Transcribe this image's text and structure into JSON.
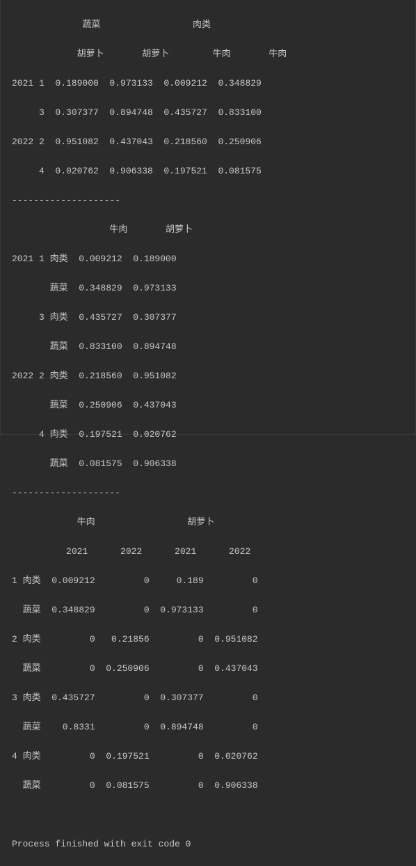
{
  "separator": "--------------------",
  "exit_message": "Process finished with exit code 0",
  "block1": {
    "header1": "             蔬菜                 肉类          ",
    "header2": "            胡萝卜       胡萝卜        牛肉       牛肉",
    "rows": [
      "2021 1  0.189000  0.973133  0.009212  0.348829",
      "     3  0.307377  0.894748  0.435727  0.833100",
      "2022 2  0.951082  0.437043  0.218560  0.250906",
      "     4  0.020762  0.906338  0.197521  0.081575"
    ]
  },
  "block2": {
    "header": "                  牛肉       胡萝卜",
    "rows": [
      "2021 1 肉类  0.009212  0.189000",
      "       蔬菜  0.348829  0.973133",
      "     3 肉类  0.435727  0.307377",
      "       蔬菜  0.833100  0.894748",
      "2022 2 肉类  0.218560  0.951082",
      "       蔬菜  0.250906  0.437043",
      "     4 肉类  0.197521  0.020762",
      "       蔬菜  0.081575  0.906338"
    ]
  },
  "block3": {
    "header1": "            牛肉                 胡萝卜          ",
    "header2": "          2021      2022      2021      2022",
    "rows": [
      "1 肉类  0.009212         0     0.189         0",
      "  蔬菜  0.348829         0  0.973133         0",
      "2 肉类         0   0.21856         0  0.951082",
      "  蔬菜         0  0.250906         0  0.437043",
      "3 肉类  0.435727         0  0.307377         0",
      "  蔬菜    0.8331         0  0.894748         0",
      "4 肉类         0  0.197521         0  0.020762",
      "  蔬菜         0  0.081575         0  0.906338"
    ]
  }
}
